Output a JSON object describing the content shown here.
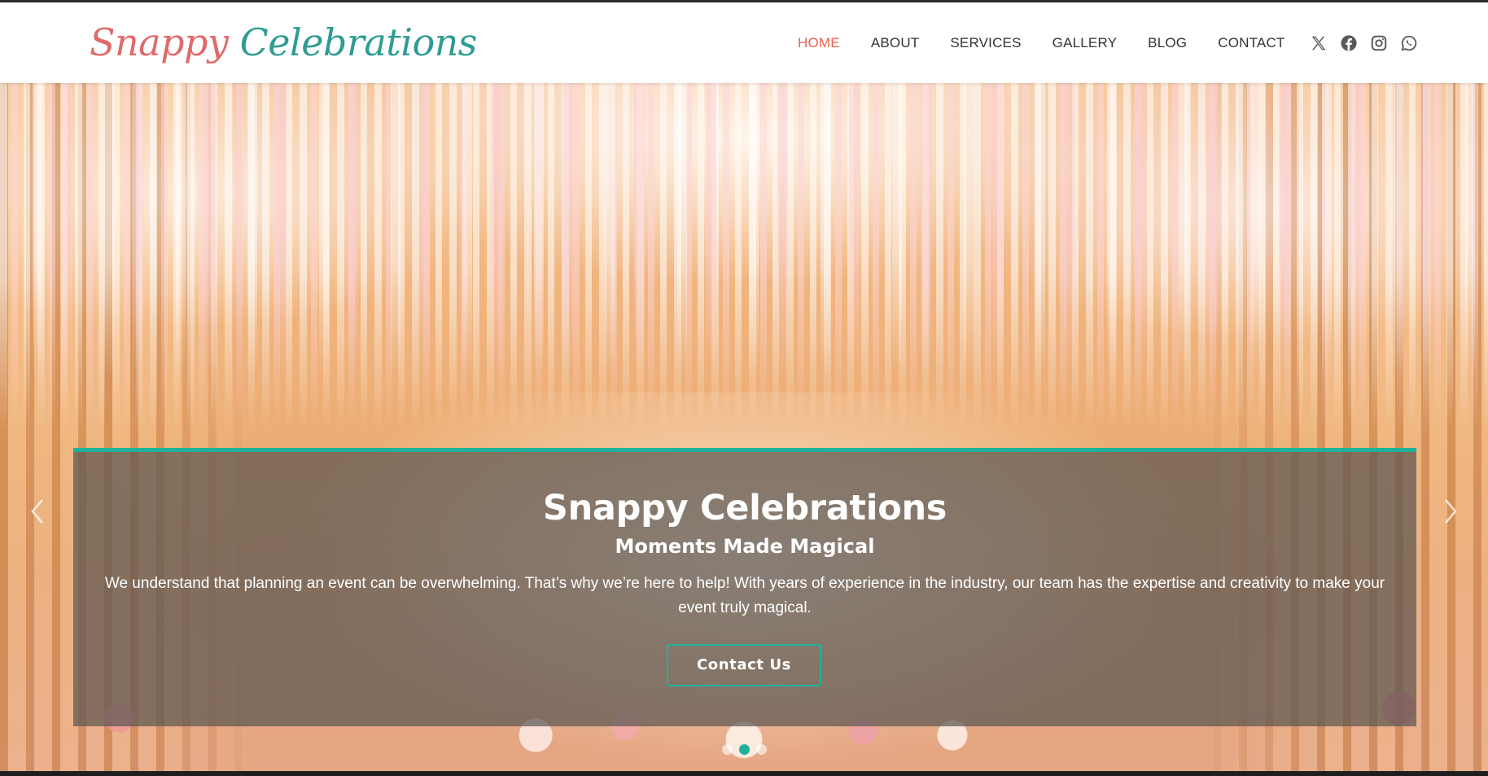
{
  "brand": {
    "logo_word1": "Snappy",
    "logo_word2": "Celebrations",
    "logo_color1": "#e06a6a",
    "logo_color2": "#2f9c93"
  },
  "nav": {
    "items": [
      {
        "label": "HOME",
        "active": true
      },
      {
        "label": "ABOUT",
        "active": false
      },
      {
        "label": "SERVICES",
        "active": false
      },
      {
        "label": "GALLERY",
        "active": false
      },
      {
        "label": "BLOG",
        "active": false
      },
      {
        "label": "CONTACT",
        "active": false
      }
    ],
    "active_color": "#f0604d",
    "social_icons": [
      "x-icon",
      "facebook-icon",
      "instagram-icon",
      "whatsapp-icon"
    ]
  },
  "hero": {
    "title": "Snappy Celebrations",
    "subtitle": "Moments Made Magical",
    "description": "We understand that planning an event can be overwhelming. That’s why we’re here to help! With years of experience in the industry, our team has the expertise and creativity to make your event truly magical.",
    "cta_label": "Contact Us",
    "accent_color": "#1fb29a",
    "slides_total": 3,
    "active_slide": 2
  }
}
